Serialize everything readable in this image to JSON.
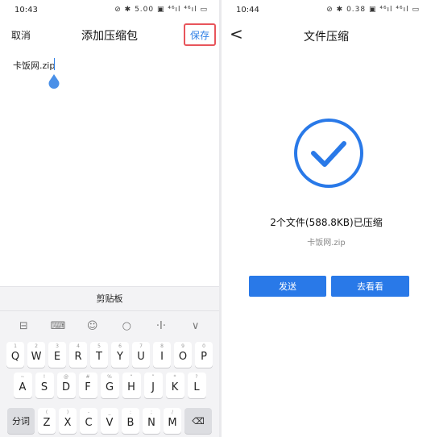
{
  "left": {
    "status": {
      "time": "10:43",
      "icons": "⊘ ✱ 5.00 ▣ ⁴⁶ıl ⁴⁶ıl ▭"
    },
    "header": {
      "cancel": "取消",
      "title": "添加压缩包",
      "save": "保存"
    },
    "filename": "卡饭网.zip",
    "keyboard": {
      "title": "剪贴板",
      "toolbar": [
        "⊟",
        "⌨",
        "☺",
        "○",
        "·I·",
        "∨"
      ],
      "row1": [
        {
          "sup": "1",
          "key": "Q"
        },
        {
          "sup": "2",
          "key": "W"
        },
        {
          "sup": "3",
          "key": "E"
        },
        {
          "sup": "4",
          "key": "R"
        },
        {
          "sup": "5",
          "key": "T"
        },
        {
          "sup": "6",
          "key": "Y"
        },
        {
          "sup": "7",
          "key": "U"
        },
        {
          "sup": "8",
          "key": "I"
        },
        {
          "sup": "9",
          "key": "O"
        },
        {
          "sup": "0",
          "key": "P"
        }
      ],
      "row2": [
        {
          "sup": "~",
          "key": "A"
        },
        {
          "sup": "!",
          "key": "S"
        },
        {
          "sup": "@",
          "key": "D"
        },
        {
          "sup": "#",
          "key": "F"
        },
        {
          "sup": "%",
          "key": "G"
        },
        {
          "sup": "“",
          "key": "H"
        },
        {
          "sup": "”",
          "key": "J"
        },
        {
          "sup": "*",
          "key": "K"
        },
        {
          "sup": "?",
          "key": "L"
        }
      ],
      "row3_left": "分词",
      "row3": [
        {
          "sup": "(",
          "key": "Z"
        },
        {
          "sup": ")",
          "key": "X"
        },
        {
          "sup": "-",
          "key": "C"
        },
        {
          "sup": "_",
          "key": "V"
        },
        {
          "sup": ":",
          "key": "B"
        },
        {
          "sup": ";",
          "key": "N"
        },
        {
          "sup": "/",
          "key": "M"
        }
      ],
      "row3_right": "⌫"
    }
  },
  "right": {
    "status": {
      "time": "10:44",
      "icons": "⊘ ✱ 0.38 ▣ ⁴⁶ıl ⁴⁶ıl ▭"
    },
    "header": {
      "back": "<",
      "title": "文件压缩"
    },
    "message": "2个文件(588.8KB)已压缩",
    "filename": "卡饭网.zip",
    "buttons": {
      "send": "发送",
      "view": "去看看"
    }
  },
  "colors": {
    "accent": "#2979e8",
    "highlight": "#e8555b"
  }
}
